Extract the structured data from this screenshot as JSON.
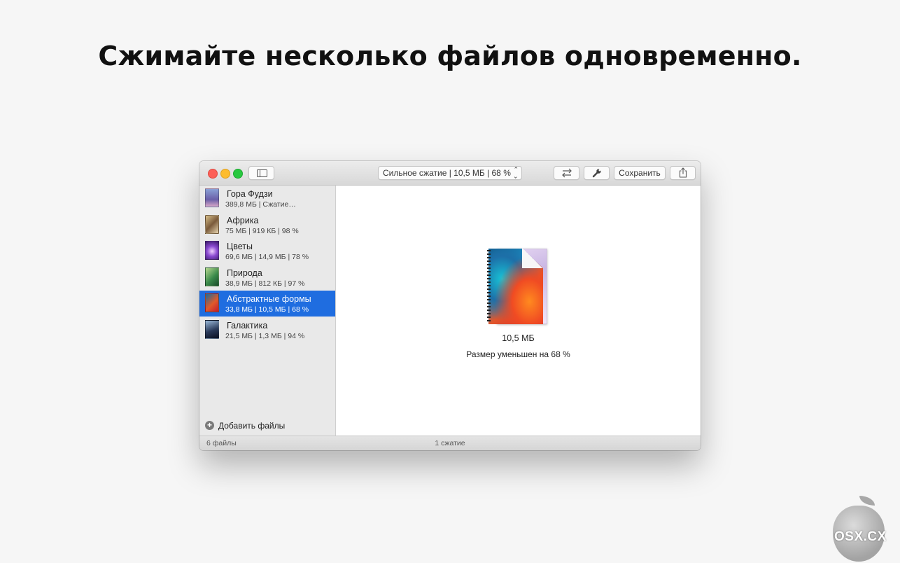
{
  "headline": "Сжимайте несколько файлов одновременно.",
  "window": {
    "preset": "Сильное сжатие | 10,5 МБ | 68 %",
    "save_label": "Сохранить"
  },
  "files": [
    {
      "name": "Гора Фудзи",
      "meta": "389,8 МБ | Сжатие…",
      "selected": false
    },
    {
      "name": "Африка",
      "meta": "75 МБ | 919 КБ | 98 %",
      "selected": false
    },
    {
      "name": "Цветы",
      "meta": "69,6 МБ | 14,9 МБ | 78 %",
      "selected": false
    },
    {
      "name": "Природа",
      "meta": "38,9 МБ | 812 КБ | 97 %",
      "selected": false
    },
    {
      "name": "Абстрактные формы",
      "meta": "33,8 МБ | 10,5 МБ | 68 %",
      "selected": true
    },
    {
      "name": "Галактика",
      "meta": "21,5 МБ | 1,3 МБ | 94 %",
      "selected": false
    }
  ],
  "add_files_label": "Добавить файлы",
  "result": {
    "size": "10,5 МБ",
    "reduction": "Размер уменьшен на 68 %"
  },
  "statusbar": {
    "left": "6 файлы",
    "center": "1 сжатие"
  },
  "watermark": "OSX.CX",
  "colors": {
    "selection": "#1f6de0",
    "traffic_red": "#fc5f57",
    "traffic_yellow": "#fdbc2e",
    "traffic_green": "#28c840"
  }
}
